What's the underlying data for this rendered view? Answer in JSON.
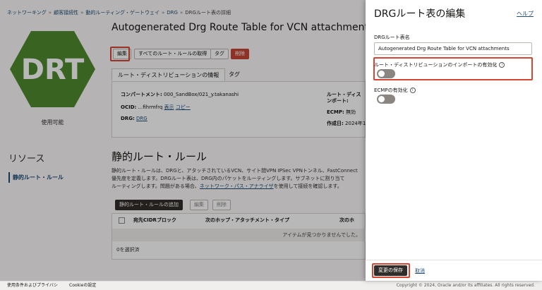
{
  "breadcrumb": [
    "ネットワーキング",
    "顧客接続性",
    "動的ルーティング・ゲートウェイ",
    "DRG",
    "DRGルート表の詳細"
  ],
  "badge": {
    "text": "DRT",
    "color": "#4f8a2f"
  },
  "status": "使用可能",
  "resources": {
    "title": "リソース",
    "item": "静的ルート・ルール"
  },
  "page_title": "Autogenerated Drg Route Table for VCN attachments",
  "actions": {
    "edit": "編集",
    "get_all": "すべてのルート・ルールの取得",
    "tags": "タグ",
    "delete": "削除"
  },
  "tabs": {
    "info": "ルート・ディストリビューションの情報",
    "tags": "タグ"
  },
  "info": {
    "compartment_label": "コンパートメント:",
    "compartment_value": "000_SandBox/021_y.takanashi",
    "ocid_label": "OCID:",
    "ocid_value": "...fihrmfrq",
    "ocid_show": "表示",
    "ocid_copy": "コピー",
    "drg_label": "DRG:",
    "drg_value": "DRG",
    "import_label_1": "ルート・ディス",
    "import_label_2": "ンポート:",
    "ecmp_label": "ECMP:",
    "ecmp_value": "無効",
    "created_label": "作成日:",
    "created_value": "2024年1"
  },
  "static_rules": {
    "title": "静的ルート・ルール",
    "desc1": "静的ルート・ルールは、DRGと、アタッチされているVCN、サイト間VPN IPSec VPNトンネル、FastConnect",
    "desc2": "優先度を定義します。DRGルート表は、DRG内のパケットをルーティングします。サブネットに割り当て",
    "desc3_pre": "ルーティングします。問題がある場合、",
    "desc3_link": "ネットワーク・パス・アナライザ",
    "desc3_post": "を使用して接続を確認します。",
    "add_button": "静的ルート・ルールの追加",
    "edit_button": "編集",
    "delete_button": "削除",
    "columns": [
      "宛先CIDRブロック",
      "次のホップ・アタッチメント・タイプ",
      "次のホ"
    ],
    "empty": "アイテムが見つかりませんでした。",
    "selected": "0を選択済"
  },
  "footer": {
    "terms": "使用条件およびプライバシ",
    "cookie": "Cookieの設定",
    "copyright": "Copyright © 2024, Oracle and/or its affiliates. All rights reserved."
  },
  "panel": {
    "title": "DRGルート表の編集",
    "help": "ヘルプ",
    "name_label": "DRGルート表名",
    "name_value": "Autogenerated Drg Route Table for VCN attachments",
    "import_label": "ルート・ディストリビューションのインポートの有効化",
    "ecmp_label": "ECMPの有効化",
    "import_enabled": false,
    "ecmp_enabled": false,
    "save": "変更の保存",
    "cancel": "取消"
  },
  "colors": {
    "accent": "#1f4e79",
    "highlight": "#d64532",
    "delete": "#c74634",
    "primary": "#312d2a"
  }
}
